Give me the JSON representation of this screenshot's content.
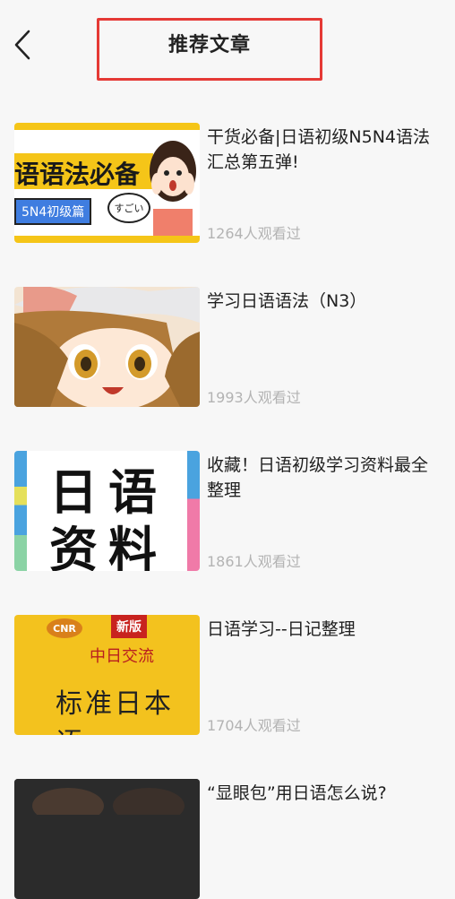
{
  "header": {
    "title": "推荐文章"
  },
  "articles": [
    {
      "title": "干货必备|日语初级N5N4语法汇总第五弹!",
      "views": "1264人观看过",
      "thumb": {
        "headline": "语语法必备",
        "tag": "5N4初级篇",
        "bubble": "すごい"
      }
    },
    {
      "title": "学习日语语法（N3）",
      "views": "1993人观看过"
    },
    {
      "title": "收藏！日语初级学习资料最全整理",
      "views": "1861人观看过",
      "thumb": {
        "line1": "日语",
        "line2": "资料"
      }
    },
    {
      "title": "日语学习--日记整理",
      "views": "1704人观看过",
      "thumb": {
        "logo": "CNR",
        "badge": "新版",
        "sub": "中日交流",
        "main": "标准日本语"
      }
    },
    {
      "title": "“显眼包”用日语怎么说?",
      "views": ""
    }
  ],
  "colors": {
    "accent_red": "#e53935",
    "muted_text": "#b3b3b3",
    "background": "#f7f7f7"
  },
  "icons": {
    "back": "chevron-left-icon"
  }
}
